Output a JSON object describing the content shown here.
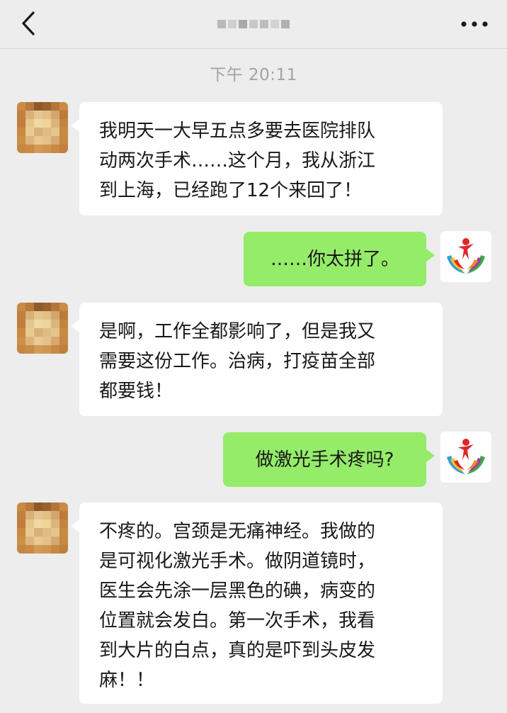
{
  "header": {
    "title": "",
    "back_icon": "chevron-left-icon",
    "more_icon": "more-dots-icon"
  },
  "timestamp": "下午 20:11",
  "messages": [
    {
      "from": "contact",
      "text": "我明天一大早五点多要去医院排队\n动两次手术……这个月，我从浙江\n到上海，已经跑了12个来回了！"
    },
    {
      "from": "me",
      "text": "……你太拼了。"
    },
    {
      "from": "contact",
      "text": "是啊，工作全都影响了，但是我又\n需要这份工作。治病，打疫苗全部\n都要钱！"
    },
    {
      "from": "me",
      "text": "做激光手术疼吗?"
    },
    {
      "from": "contact",
      "text": "不疼的。宫颈是无痛神经。我做的\n是可视化激光手术。做阴道镜时，\n医生会先涂一层黑色的碘，病变的\n位置就会发白。第一次手术，我看\n到大片的白点，真的是吓到头皮发\n麻！！"
    }
  ],
  "colors": {
    "background": "#ededed",
    "incoming_bubble": "#ffffff",
    "outgoing_bubble": "#95ec69",
    "text": "#191919",
    "timestamp": "#a3a3a3"
  }
}
